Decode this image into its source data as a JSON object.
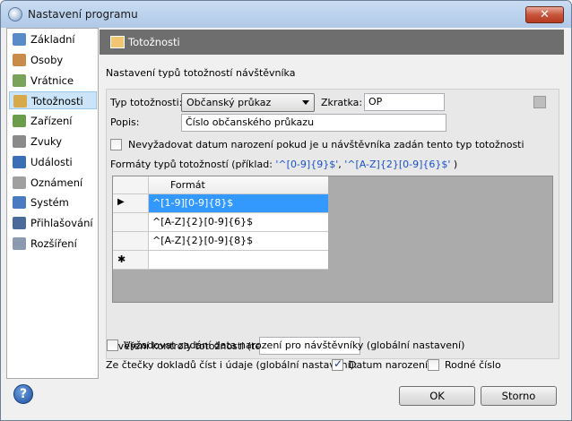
{
  "window": {
    "title": "Nastavení programu",
    "close_glyph": "✕"
  },
  "sidebar": {
    "items": [
      {
        "label": "Základní",
        "icon": "settings-icon",
        "color": "#5a8bc9"
      },
      {
        "label": "Osoby",
        "icon": "people-icon",
        "color": "#c98a4a"
      },
      {
        "label": "Vrátnice",
        "icon": "gate-icon",
        "color": "#7aa35a"
      },
      {
        "label": "Totožnosti",
        "icon": "id-card-icon",
        "color": "#d6a94a",
        "selected": true
      },
      {
        "label": "Zařízení",
        "icon": "device-icon",
        "color": "#6b9c4a"
      },
      {
        "label": "Zvuky",
        "icon": "speaker-icon",
        "color": "#8a8a8a"
      },
      {
        "label": "Události",
        "icon": "events-icon",
        "color": "#3a6fb5"
      },
      {
        "label": "Oznámení",
        "icon": "notification-icon",
        "color": "#a0a0a0"
      },
      {
        "label": "Systém",
        "icon": "system-icon",
        "color": "#4a7ac0"
      },
      {
        "label": "Přihlašování",
        "icon": "login-icon",
        "color": "#4a6a9a"
      },
      {
        "label": "Rozšíření",
        "icon": "extension-icon",
        "color": "#8a9ab0"
      }
    ]
  },
  "content": {
    "header_title": "Totožnosti",
    "section_label": "Nastavení typů totožností návštěvníka",
    "type_label": "Typ totožnosti:",
    "type_value": "Občanský průkaz",
    "abbrev_label": "Zkratka:",
    "abbrev_value": "OP",
    "description_label": "Popis:",
    "description_value": "Číslo občanského průkazu",
    "no_birthdate_label": "Nevyžadovat datum narození pokud je u návštěvníka zadán tento typ totožnosti",
    "formats_label": "Formáty typů totožností (příklad: ",
    "formats_example_1": "'^[0-9]{9}$'",
    "formats_sep": ", ",
    "formats_example_2": "'^[A-Z]{2}[0-9]{6}$'",
    "formats_end": " )",
    "grid": {
      "column_header": "Formát",
      "rows": [
        "^[1-9][0-9]{8}$",
        "^[A-Z]{2}[0-9]{6}$",
        "^[A-Z]{2}[0-9]{8}$"
      ],
      "new_row_marker": "✱",
      "current_row_marker": "▶"
    },
    "verify_label": "Ověření kontroly totožnosti (test):",
    "verify_value": "",
    "require_birthdate_label": "Vyžadovat zadání data narození pro návštěvníky (globální nastavení)",
    "reader_label": "Ze čtečky dokladů číst i údaje (globální nastavení):",
    "birthdate_label": "Datum narození",
    "birthdate_checked": true,
    "personal_id_label": "Rodné číslo",
    "personal_id_checked": false
  },
  "footer": {
    "help": "?",
    "ok": "OK",
    "cancel": "Storno"
  }
}
